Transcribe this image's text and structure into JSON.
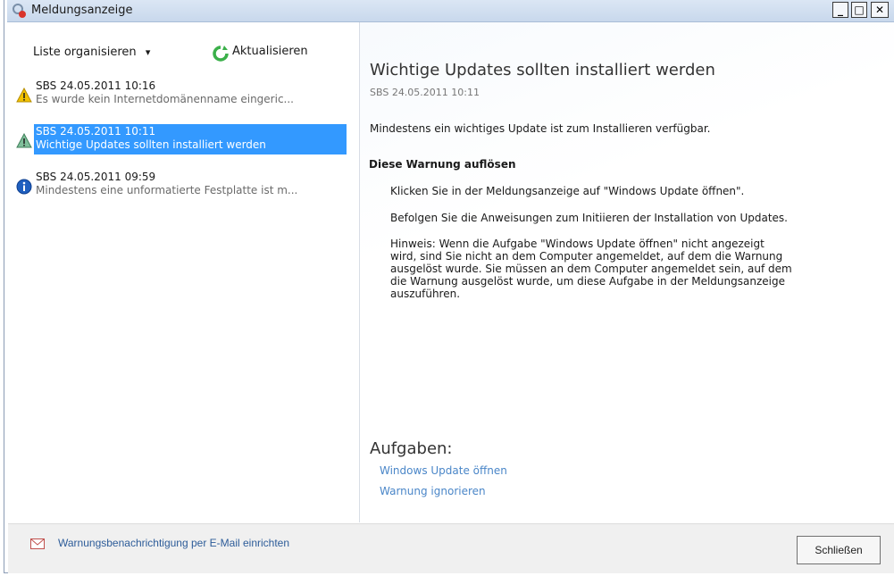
{
  "window": {
    "title": "Meldungsanzeige",
    "minimize_glyph": "_",
    "maximize_glyph": "□",
    "close_glyph": "✕"
  },
  "toolbar": {
    "organize_label": "Liste organisieren",
    "organize_arrow": "▾",
    "refresh_label": "Aktualisieren"
  },
  "messages": [
    {
      "icon": "warning-icon",
      "line1": "SBS 24.05.2011 10:16",
      "line2": "Es wurde kein Internetdomänenname eingeric...",
      "selected": false
    },
    {
      "icon": "warning-icon",
      "line1": "SBS 24.05.2011 10:11",
      "line2": "Wichtige Updates sollten installiert werden",
      "selected": true
    },
    {
      "icon": "info-icon",
      "line1": "SBS 24.05.2011 09:59",
      "line2": "Mindestens eine unformatierte Festplatte ist m...",
      "selected": false
    }
  ],
  "detail": {
    "title": "Wichtige Updates sollten installiert werden",
    "subtitle": "SBS 24.05.2011 10:11",
    "summary": "Mindestens ein wichtiges Update ist zum Installieren verfügbar.",
    "resolve_heading": "Diese Warnung auflösen",
    "step1": "Klicken Sie in der Meldungsanzeige auf \"Windows Update öffnen\".",
    "step2": "Befolgen Sie die Anweisungen zum Initiieren der Installation von Updates.",
    "note_l1": "Hinweis: Wenn die Aufgabe \"Windows Update öffnen\" nicht angezeigt",
    "note_l2": "wird, sind Sie nicht an dem Computer angemeldet, auf dem die Warnung",
    "note_l3": "ausgelöst wurde. Sie müssen an dem Computer angemeldet sein, auf dem",
    "note_l4": "die Warnung ausgelöst wurde, um diese Aufgabe in der Meldungsanzeige",
    "note_l5": "auszuführen."
  },
  "tasks": {
    "heading": "Aufgaben:",
    "links": [
      "Windows Update öffnen",
      "Warnung ignorieren"
    ]
  },
  "footer": {
    "email_link": "Warnungsbenachrichtigung per E-Mail einrichten",
    "close_button": "Schließen"
  },
  "colors": {
    "selection": "#3399ff",
    "link": "#4a86c8",
    "warning": "#f2c200",
    "info": "#1f5fbf"
  }
}
